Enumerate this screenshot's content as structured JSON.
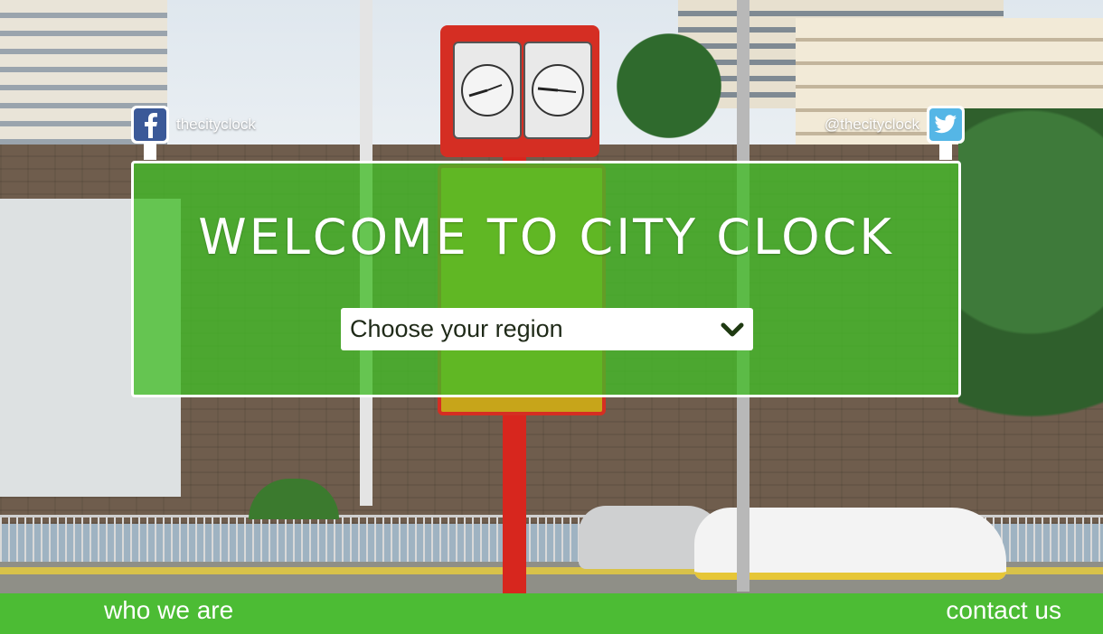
{
  "social": {
    "facebook_handle": "thecityclock",
    "twitter_handle": "@thecityclock",
    "facebook_icon": "facebook-icon",
    "twitter_icon": "twitter-icon"
  },
  "hero": {
    "title": "WELCOME TO CITY CLOCK",
    "region_select": {
      "selected": "Choose your region",
      "icon": "chevron-down-icon"
    }
  },
  "footer": {
    "links": [
      {
        "label": "who we are"
      },
      {
        "label": "contact us"
      }
    ]
  },
  "colors": {
    "accent_green": "#4cbc34",
    "panel_overlay": "#43bc28",
    "facebook_blue": "#3b5998",
    "twitter_blue": "#55b6e6",
    "chevron": "#1f3a12"
  }
}
